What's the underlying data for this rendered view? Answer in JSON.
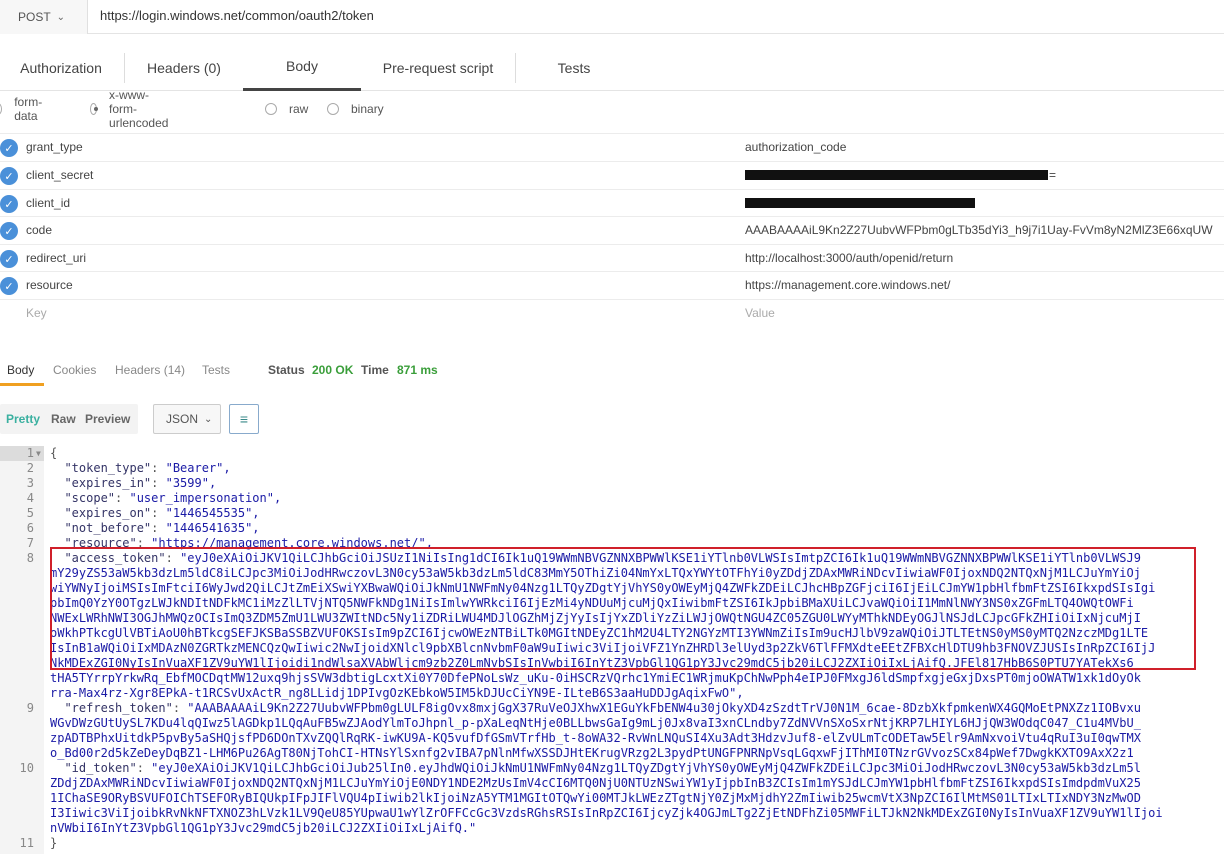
{
  "url_bar": {
    "method": "POST",
    "url": "https://login.windows.net/common/oauth2/token"
  },
  "request_tabs": [
    "Authorization",
    "Headers (0)",
    "Body",
    "Pre-request script",
    "Tests"
  ],
  "body_types": [
    "form-data",
    "x-www-form-urlencoded",
    "raw",
    "binary"
  ],
  "params": [
    {
      "key": "grant_type",
      "value": "authorization_code"
    },
    {
      "key": "client_secret",
      "value": "="
    },
    {
      "key": "client_id",
      "value": ""
    },
    {
      "key": "code",
      "value": "AAABAAAAiL9Kn2Z27UubvWFPbm0gLTb35dYi3_h9j7i1Uay-FvVm8yN2MlZ3E66xqUW"
    },
    {
      "key": "redirect_uri",
      "value": "http://localhost:3000/auth/openid/return"
    },
    {
      "key": "resource",
      "value": "https://management.core.windows.net/"
    }
  ],
  "params_placeholder": {
    "key": "Key",
    "value": "Value"
  },
  "response_tabs": [
    "Body",
    "Cookies",
    "Headers (14)",
    "Tests"
  ],
  "status": {
    "label": "Status",
    "value": "200 OK",
    "time_label": "Time",
    "time_value": "871 ms"
  },
  "view_modes": [
    "Pretty",
    "Raw",
    "Preview"
  ],
  "format": "JSON",
  "code_lines": [
    {
      "n": "1",
      "text": "{"
    },
    {
      "n": "2",
      "text": "  \"token_type\": \"Bearer\","
    },
    {
      "n": "3",
      "text": "  \"expires_in\": \"3599\","
    },
    {
      "n": "4",
      "text": "  \"scope\": \"user_impersonation\","
    },
    {
      "n": "5",
      "text": "  \"expires_on\": \"1446545535\","
    },
    {
      "n": "6",
      "text": "  \"not_before\": \"1446541635\","
    },
    {
      "n": "7",
      "text": "  \"resource\": \"https://management.core.windows.net/\","
    },
    {
      "n": "8",
      "text": "  \"access_token\": \"eyJ0eXAiOiJKV1QiLCJhbGciOiJSUzI1NiIsIng1dCI6Ik1uQ19WWmNBVGZNNXBPWWlKSE1iYTlnb0VLWSIsImtpZCI6Ik1uQ19WWmNBVGZNNXBPWWlKSE1iYTlnb0VLWSJ9"
    },
    {
      "n": "",
      "text": "mY29yZS53aW5kb3dzLm5ldC8iLCJpc3MiOiJodHRwczovL3N0cy53aW5kb3dzLm5ldC83MmY5OThiZi04NmYxLTQxYWYtOTFhYi0yZDdjZDAxMWRiNDcvIiwiaWF0IjoxNDQ2NTQxNjM1LCJuYmYiOj"
    },
    {
      "n": "",
      "text": "wiYWNyIjoiMSIsImFtciI6WyJwd2QiLCJtZmEiXSwiYXBwaWQiOiJkNmU1NWFmNy04Nzg1LTQyZDgtYjVhYS0yOWEyMjQ4ZWFkZDEiLCJhcHBpZGFjciI6IjEiLCJmYW1pbHlfbmFtZSI6IkxpdSIsIgi"
    },
    {
      "n": "",
      "text": "pbImQ0YzY0OTgzLWJkNDItNDFkMC1iMzZlLTVjNTQ5NWFkNDg1NiIsImlwYWRkciI6IjEzMi4yNDUuMjcuMjQxIiwibmFtZSI6IkJpbiBMaXUiLCJvaWQiOiI1MmNlNWY3NS0xZGFmLTQ4OWQtOWFi"
    },
    {
      "n": "",
      "text": "NWExLWRhNWI3OGJhMWQzOCIsImQ3ZDM5ZmU1LWU3ZWItNDc5Ny1iZDRiLWU4MDJlOGZhMjZjYyIsIjYxZDliYzZiLWJjOWQtNGU4ZC05ZGU0LWYyMThkNDEyOGJlNSJdLCJpcGFkZHIiOiIxNjcuMjI"
    },
    {
      "n": "",
      "text": "oWkhPTkcgUlVBTiAoU0hBTkcgSEFJKSBaSSBZVUFOKSIsIm9pZCI6IjcwOWEzNTBiLTk0MGItNDEyZC1hM2U4LTY2NGYzMTI3YWNmZiIsIm9ucHJlbV9zaWQiOiJTLTEtNS0yMS0yMTQ2NzczMDg1LTE"
    },
    {
      "n": "",
      "text": "IsInB1aWQiOiIxMDAzN0ZGRTkzMENCQzQwIiwic2NwIjoidXNlcl9pbXBlcnNvbmF0aW9uIiwic3ViIjoiVFZ1YnZHRDl3elUyd3p2ZkV6TlFFMXdteEEtZFBXcHlDTU9hb3FNOVZJUSIsInRpZCI6IjJ"
    },
    {
      "n": "",
      "text": "NkMDExZGI0NyIsInVuaXF1ZV9uYW1lIjoidi1ndWlsaXVAbWljcm9zb2Z0LmNvbSIsInVwbiI6InYtZ3VpbGl1QG1pY3Jvc29mdC5jb20iLCJ2ZXIiOiIxLjAifQ.JFEl817HbB6S0PTU7YATekXs6"
    },
    {
      "n": "",
      "text": "tHA5TYrrpYrkwRq_EbfMOCDqtMW12uxq9hjsSVW3dbtigLcxtXi0Y70DfePNoLsWz_uKu-0iHSCRzVQrhc1YmiEC1WRjmuKpChNwPph4eIPJ0FMxgJ6ldSmpfxgjeGxjDxsPT0mjoOWATW1xk1dOyOk"
    },
    {
      "n": "",
      "text": "rra-Max4rz-Xgr8EPkA-t1RCSvUxActR_ng8LLidj1DPIvgOzKEbkoW5IM5kDJUcCiYN9E-ILteB6S3aaHuDDJgAqixFwO\","
    },
    {
      "n": "9",
      "text": "  \"refresh_token\": \"AAABAAAAiL9Kn2Z27UubvWFPbm0gLULF8igOvx8mxjGgX37RuVeOJXhwX1EGuYkFbENW4u30jOkyXD4zSzdtTrVJ0N1M_6cae-8DzbXkfpmkenWX4GQMoEtPNXZz1IOBvxu"
    },
    {
      "n": "",
      "text": "WGvDWzGUtUySL7KDu4lqQIwz5lAGDkp1LQqAuFB5wZJAodYlmToJhpnl_p-pXaLeqNtHje0BLLbwsGaIg9mLj0Jx8vaI3xnCLndby7ZdNVVnSXoSxrNtjKRP7LHIYL6HJjQW3WOdqC047_C1u4MVbU_"
    },
    {
      "n": "",
      "text": "zpADTBPhxUitdkP5pvBy5aSHQjsfPD6DOnTXvZQQlRqRK-iwKU9A-KQ5vufDfGSmVTrfHb_t-8oWA32-RvWnLNQuSI4Xu3Adt3HdzvJuf8-elZvULmTcODETaw5Elr9AmNxvoiVtu4qRuI3uI0qwTMX"
    },
    {
      "n": "",
      "text": "o_Bd00r2d5kZeDeyDqBZ1-LHM6Pu26AgT80NjTohCI-HTNsYlSxnfg2vIBA7pNlnMfwXSSDJHtEKrugVRzg2L3pydPtUNGFPNRNpVsqLGqxwFjIThMI0TNzrGVvozSCx84pWef7DwgkKXTO9AxX2z1"
    },
    {
      "n": "10",
      "text": "  \"id_token\": \"eyJ0eXAiOiJKV1QiLCJhbGciOiJub25lIn0.eyJhdWQiOiJkNmU1NWFmNy04Nzg1LTQyZDgtYjVhYS0yOWEyMjQ4ZWFkZDEiLCJpc3MiOiJodHRwczovL3N0cy53aW5kb3dzLm5l"
    },
    {
      "n": "",
      "text": "ZDdjZDAxMWRiNDcvIiwiaWF0IjoxNDQ2NTQxNjM1LCJuYmYiOjE0NDY1NDE2MzUsImV4cCI6MTQ0NjU0NTUzNSwiYW1yIjpbInB3ZCIsIm1mYSJdLCJmYW1pbHlfbmFtZSI6IkxpdSIsImdpdmVuX25"
    },
    {
      "n": "",
      "text": "1IChaSE9ORyBSVUFOIChTSEFORyBIQUkpIFpJIFlVQU4pIiwib2lkIjoiNzA5YTM1MGItOTQwYi00MTJkLWEzZTgtNjY0ZjMxMjdhY2ZmIiwib25wcmVtX3NpZCI6IlMtMS01LTIxLTIxNDY3NzMwOD"
    },
    {
      "n": "",
      "text": "I3Iiwic3ViIjoibkRvNkNFTXNOZ3hLVzk1LV9QeU85YUpwaU1wYlZrOFFCcGc3VzdsRGhsRSIsInRpZCI6IjcyZjk4OGJmLTg2ZjEtNDFhZi05MWFiLTJkN2NkMDExZGI0NyIsInVuaXF1ZV9uYW1lIjoi"
    },
    {
      "n": "",
      "text": "nVWbiI6InYtZ3VpbGl1QG1pY3Jvc29mdC5jb20iLCJ2ZXIiOiIxLjAifQ.\""
    },
    {
      "n": "11",
      "text": "}"
    }
  ]
}
